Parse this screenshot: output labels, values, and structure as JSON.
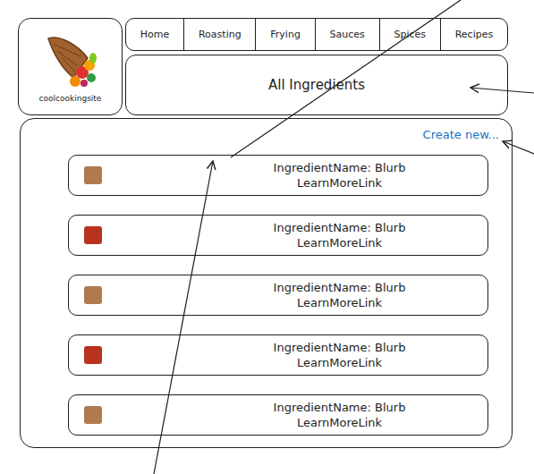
{
  "logo": {
    "text": "coolcookingsite"
  },
  "nav": {
    "items": [
      {
        "label": "Home"
      },
      {
        "label": "Roasting"
      },
      {
        "label": "Frying"
      },
      {
        "label": "Sauces"
      },
      {
        "label": "Spices"
      },
      {
        "label": "Recipes"
      }
    ]
  },
  "header": {
    "title": "All Ingredients"
  },
  "create_link": {
    "label": "Create new..."
  },
  "ingredients": [
    {
      "title": "IngredientName: Blurb",
      "link": "LearnMoreLink",
      "color": "#b07a4f"
    },
    {
      "title": "IngredientName: Blurb",
      "link": "LearnMoreLink",
      "color": "#b8321f"
    },
    {
      "title": "IngredientName: Blurb",
      "link": "LearnMoreLink",
      "color": "#b07a4f"
    },
    {
      "title": "IngredientName: Blurb",
      "link": "LearnMoreLink",
      "color": "#b8321f"
    },
    {
      "title": "IngredientName: Blurb",
      "link": "LearnMoreLink",
      "color": "#b07a4f"
    }
  ]
}
